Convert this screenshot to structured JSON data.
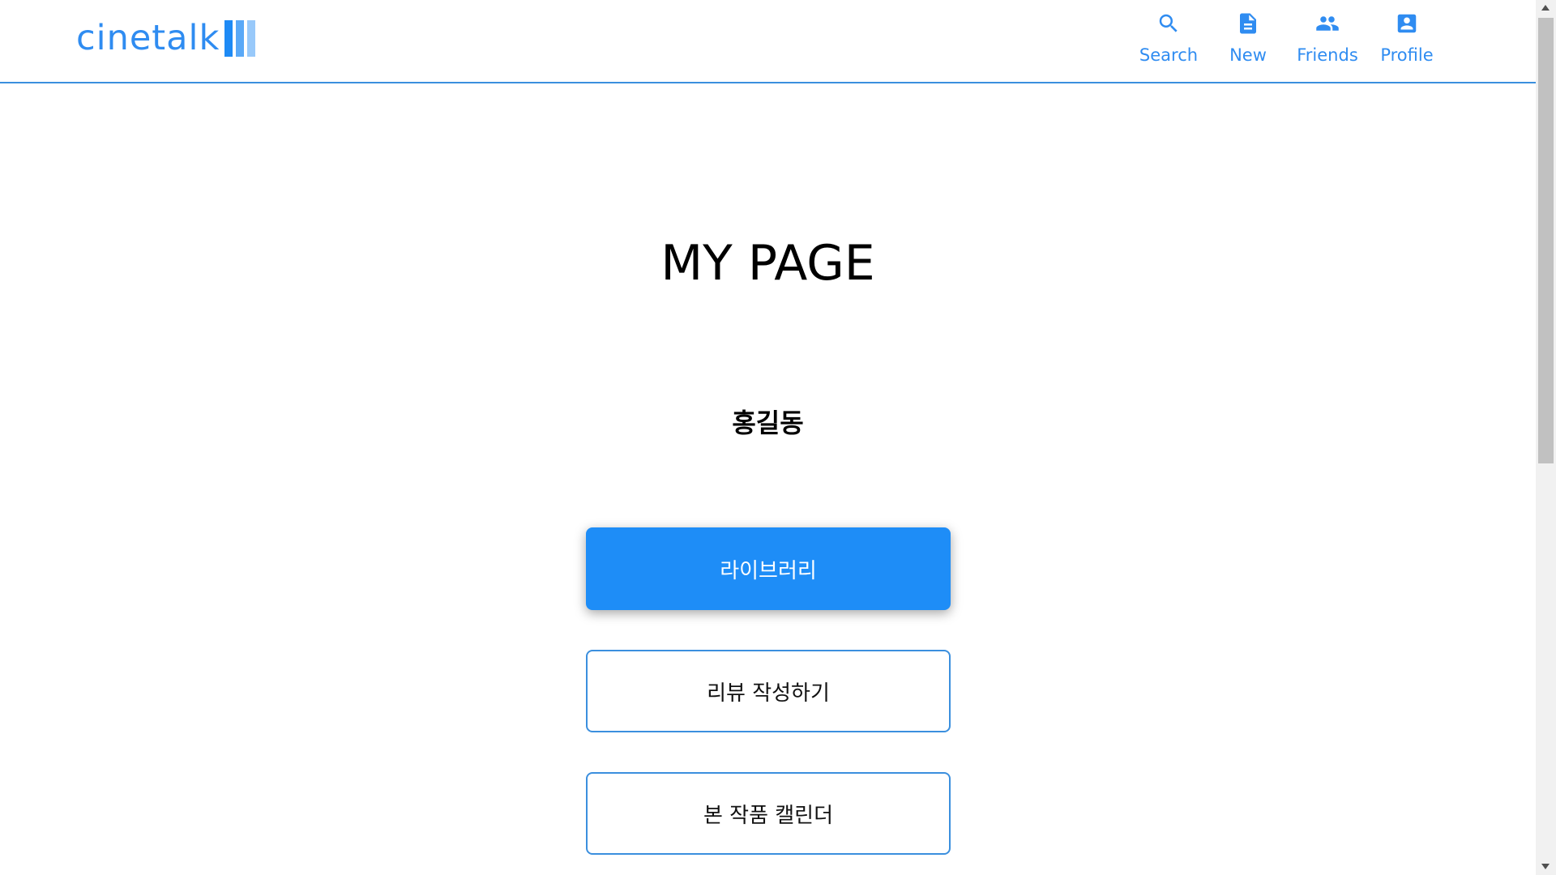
{
  "header": {
    "logo_text": "cinetalk",
    "nav": [
      {
        "label": "Search",
        "icon": "search-icon"
      },
      {
        "label": "New",
        "icon": "document-icon"
      },
      {
        "label": "Friends",
        "icon": "people-icon"
      },
      {
        "label": "Profile",
        "icon": "account-box-icon"
      }
    ]
  },
  "main": {
    "title": "MY PAGE",
    "user_name": "홍길동",
    "buttons": {
      "library": "라이브러리",
      "write_review": "리뷰 작성하기",
      "calendar": "본 작품 캘린더"
    }
  },
  "colors": {
    "accent": "#1e8df7",
    "border": "#3b8fde"
  }
}
